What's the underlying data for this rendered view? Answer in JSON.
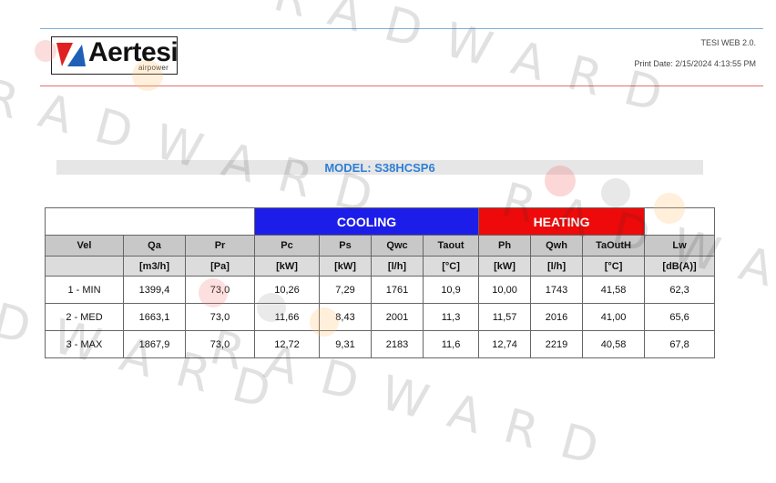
{
  "header": {
    "logo_text": "Aertesi",
    "logo_subtext": "airpower",
    "app_name": "TESI WEB 2.0.",
    "print_date": "Print Date: 2/15/2024 4:13:55 PM"
  },
  "model": {
    "label": "MODEL: S38HCSP6"
  },
  "table": {
    "groups": {
      "cooling": "COOLING",
      "heating": "HEATING"
    },
    "columns": [
      "Vel",
      "Qa",
      "Pr",
      "Pc",
      "Ps",
      "Qwc",
      "Taout",
      "Ph",
      "Qwh",
      "TaOutH",
      "Lw"
    ],
    "units": [
      "",
      "[m3/h]",
      "[Pa]",
      "[kW]",
      "[kW]",
      "[l/h]",
      "[°C]",
      "[kW]",
      "[l/h]",
      "[°C]",
      "[dB(A)]"
    ],
    "rows": [
      [
        "1 - MIN",
        "1399,4",
        "73,0",
        "10,26",
        "7,29",
        "1761",
        "10,9",
        "10,00",
        "1743",
        "41,58",
        "62,3"
      ],
      [
        "2 - MED",
        "1663,1",
        "73,0",
        "11,66",
        "8,43",
        "2001",
        "11,3",
        "11,57",
        "2016",
        "41,00",
        "65,6"
      ],
      [
        "3 - MAX",
        "1867,9",
        "73,0",
        "12,72",
        "9,31",
        "2183",
        "11,6",
        "12,74",
        "2219",
        "40,58",
        "67,8"
      ]
    ]
  },
  "watermark": {
    "line1": "RADWARD",
    "line2": "RADWARD",
    "line3": "RADWARD",
    "line4": "RADWARD",
    "line5": "RADWARD"
  },
  "colors": {
    "cooling": "#1d1dea",
    "heating": "#ee0a0a",
    "model_text": "#2e7fd6",
    "logo_red": "#e02020",
    "logo_blue": "#1e5fb8"
  }
}
